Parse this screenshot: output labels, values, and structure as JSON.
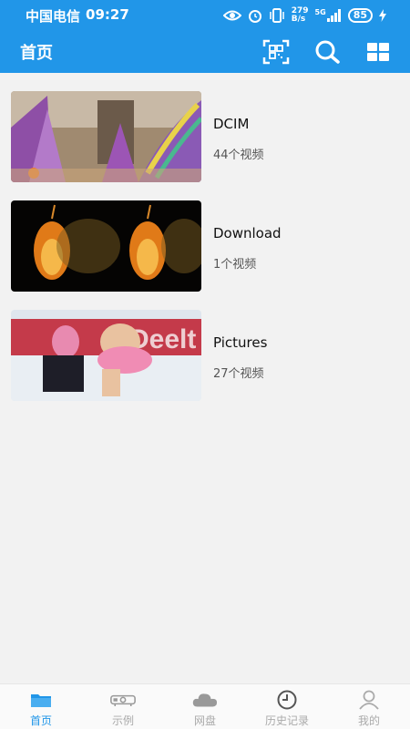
{
  "status_bar": {
    "carrier": "中国电信",
    "time": "09:27",
    "speed_top": "279",
    "speed_unit": "B/s",
    "network": "5G",
    "battery": "85"
  },
  "app_bar": {
    "title": "首页"
  },
  "folders": [
    {
      "name": "DCIM",
      "count": "44个视频"
    },
    {
      "name": "Download",
      "count": "1个视频"
    },
    {
      "name": "Pictures",
      "count": "27个视频"
    }
  ],
  "bottom_nav": [
    {
      "label": "首页",
      "icon": "folder-icon",
      "active": true
    },
    {
      "label": "示例",
      "icon": "projector-icon",
      "active": false
    },
    {
      "label": "网盘",
      "icon": "cloud-icon",
      "active": false
    },
    {
      "label": "历史记录",
      "icon": "clock-icon",
      "active": false
    },
    {
      "label": "我的",
      "icon": "person-icon",
      "active": false
    }
  ],
  "colors": {
    "primary": "#2196e8",
    "background": "#f2f2f2"
  }
}
